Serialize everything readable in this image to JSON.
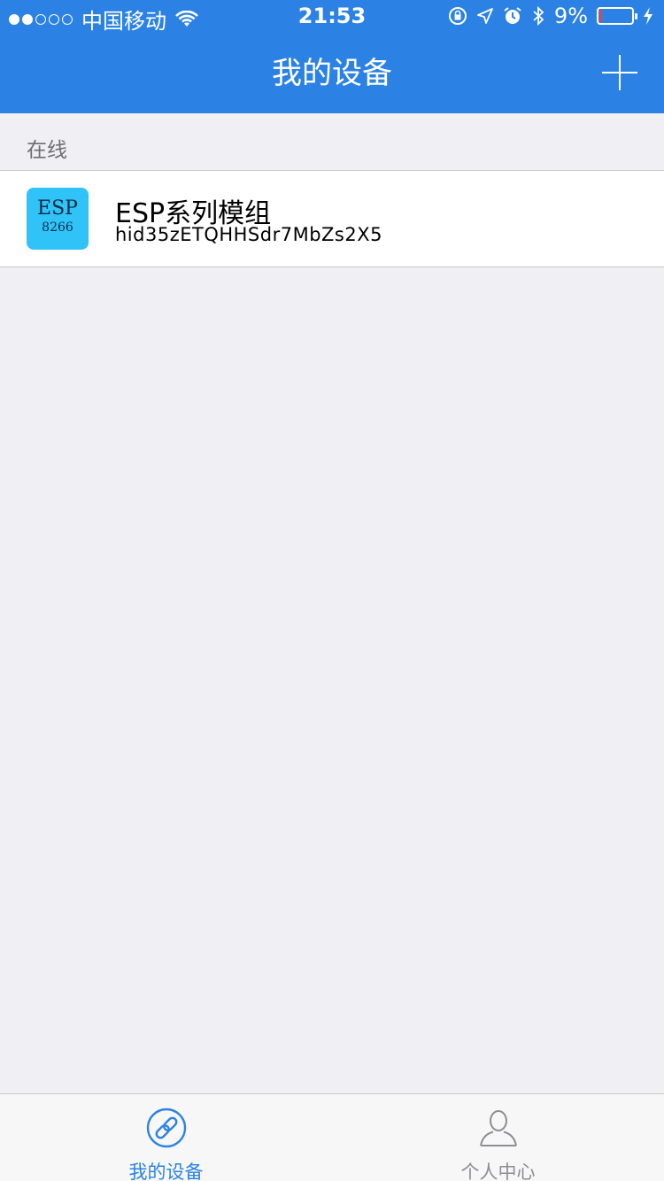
{
  "status_bar": {
    "carrier": "中国移动",
    "time": "21:53",
    "battery_percent": "9%",
    "battery_level": 0.09,
    "signal_bars_filled": 2,
    "signal_bars_total": 5,
    "icons": [
      "wifi-icon",
      "rotation-lock-icon",
      "location-icon",
      "alarm-icon",
      "bluetooth-icon",
      "charging-icon"
    ]
  },
  "nav": {
    "title": "我的设备",
    "add_icon": "plus-icon"
  },
  "section": {
    "title": "在线"
  },
  "devices": [
    {
      "icon_label": "ESP",
      "icon_sublabel": "8266",
      "icon_color": "#2fc3f7",
      "name": "ESP系列模组",
      "id": "hid35zETQHHSdr7MbZs2X5"
    }
  ],
  "tabs": [
    {
      "label": "我的设备",
      "icon": "link-icon",
      "active": true,
      "color": "#2b82e4"
    },
    {
      "label": "个人中心",
      "icon": "person-icon",
      "active": false,
      "color": "#8e8e93"
    }
  ],
  "colors": {
    "header_bg": "#2b82e4",
    "page_bg": "#efeff4",
    "battery_low": "#ff3b30"
  }
}
